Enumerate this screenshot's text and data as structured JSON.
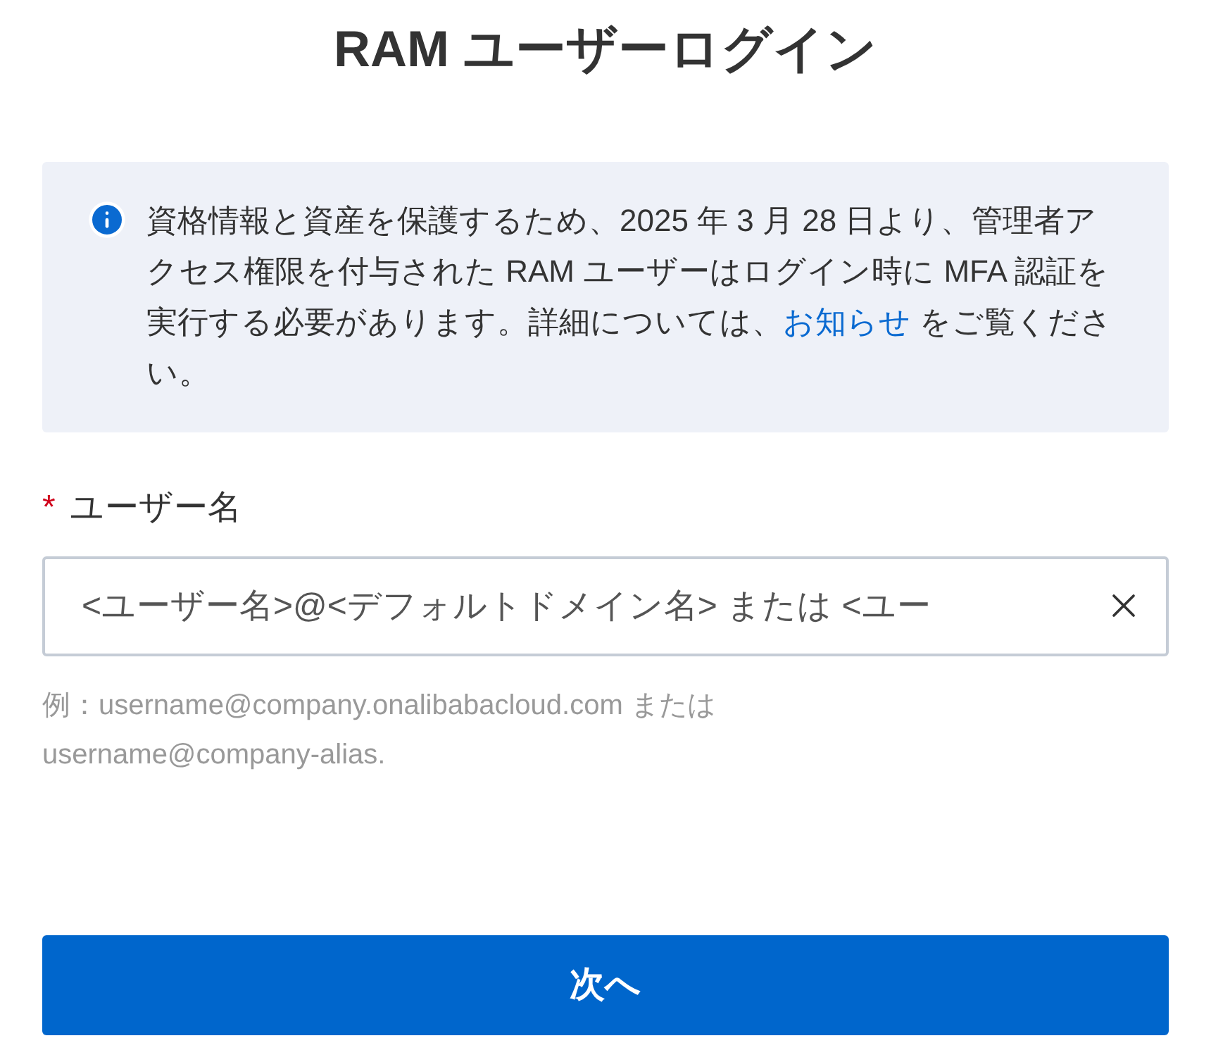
{
  "title": "RAM ユーザーログイン",
  "notice": {
    "text_before": "資格情報と資産を保護するため、2025 年 3 月 28 日より、管理者アクセス権限を付与された RAM ユーザーはログイン時に MFA 認証を実行する必要があります。詳細については、",
    "link": "お知らせ",
    "text_after": " をご覧ください。"
  },
  "username": {
    "label": "ユーザー名",
    "required_mark": "*",
    "placeholder": "<ユーザー名>@<デフォルトドメイン名> または <ユー",
    "hint": "例：username@company.onalibabacloud.com または username@company-alias."
  },
  "next_button": "次へ"
}
